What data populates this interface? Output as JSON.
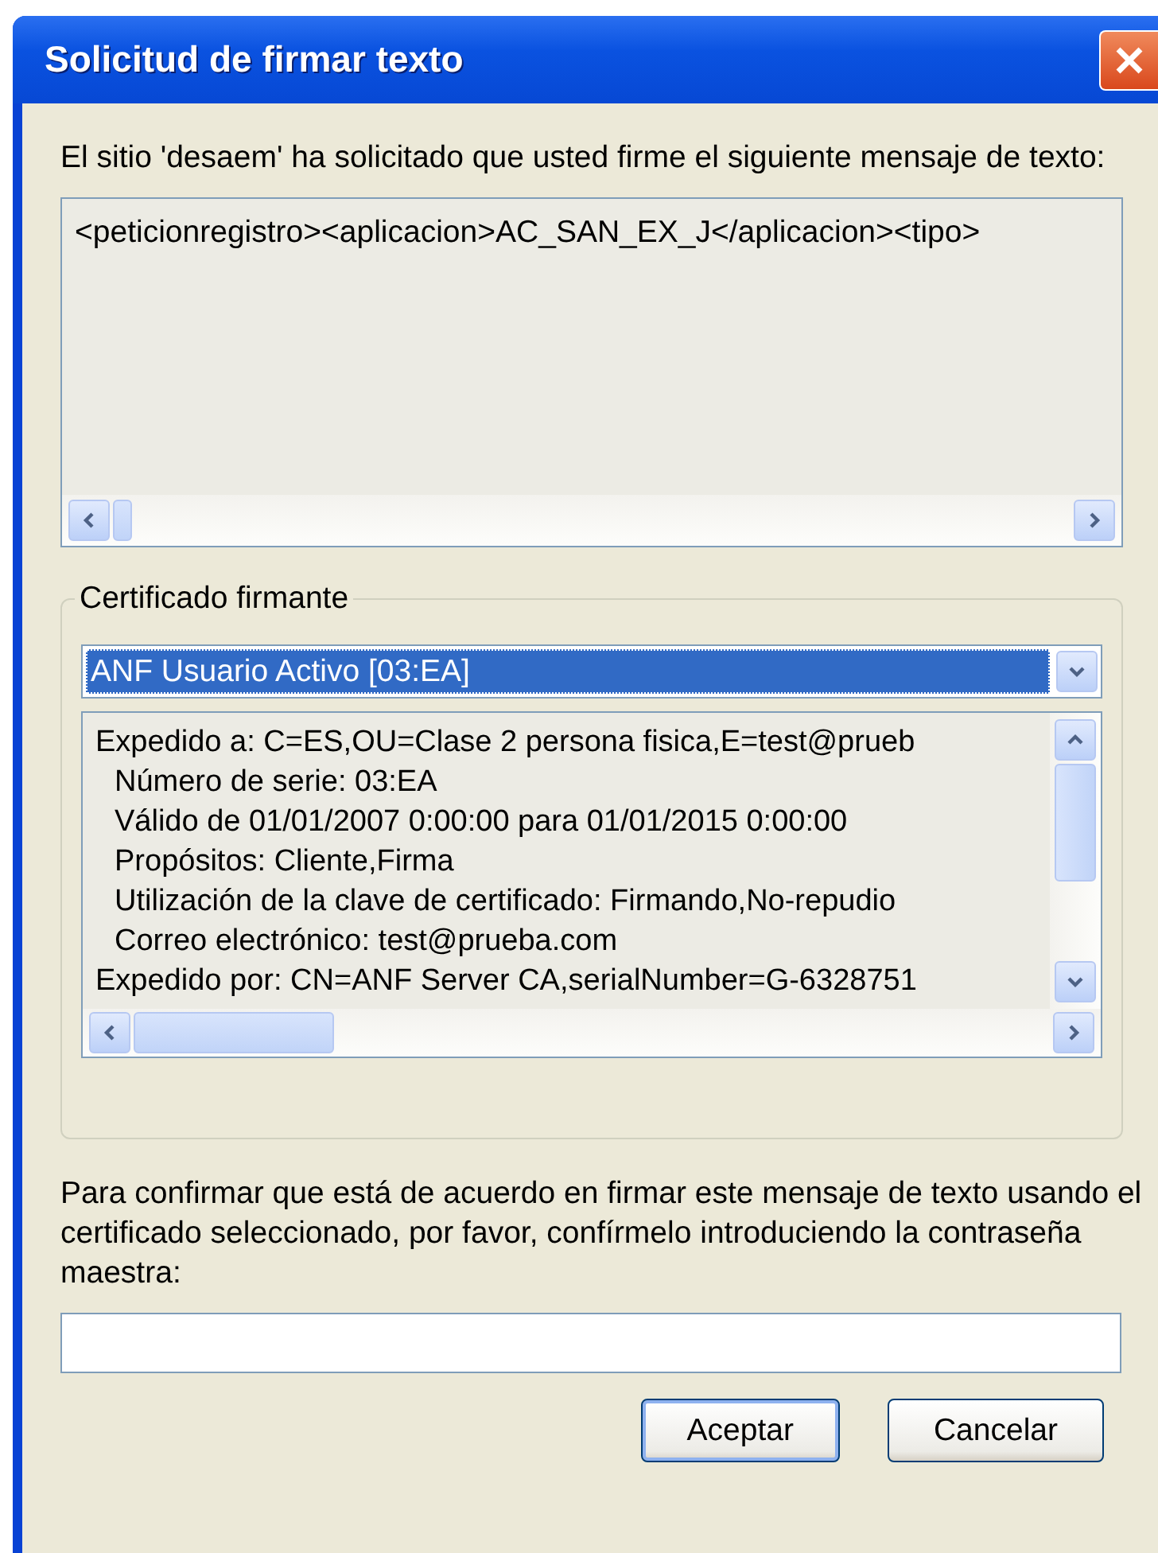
{
  "window": {
    "title": "Solicitud de firmar texto"
  },
  "intro": "El sitio 'desaem' ha solicitado que usted firme el siguiente mensaje de texto:",
  "message": {
    "text": "<peticionregistro><aplicacion>AC_SAN_EX_J</aplicacion><tipo>"
  },
  "certificate_group": {
    "label": "Certificado firmante",
    "selected_certificate": "ANF Usuario Activo [03:EA]",
    "details": [
      {
        "text": "Expedido a: C=ES,OU=Clase 2 persona fisica,E=test@prueb",
        "indented": false
      },
      {
        "text": "Número de serie: 03:EA",
        "indented": true
      },
      {
        "text": "Válido de 01/01/2007 0:00:00 para 01/01/2015 0:00:00",
        "indented": true
      },
      {
        "text": "Propósitos: Cliente,Firma",
        "indented": true
      },
      {
        "text": "Utilización de la clave de certificado: Firmando,No-repudio",
        "indented": true
      },
      {
        "text": "Correo electrónico: test@prueba.com",
        "indented": true
      },
      {
        "text": "Expedido por: CN=ANF Server CA,serialNumber=G-6328751",
        "indented": false
      }
    ]
  },
  "prompt": "Para confirmar que está de acuerdo en firmar este mensaje de texto usando el certificado seleccionado, por favor, confírmelo introduciendo la contraseña maestra:",
  "buttons": [
    {
      "label": "Aceptar",
      "default": true
    },
    {
      "label": "Cancelar",
      "default": false
    }
  ]
}
